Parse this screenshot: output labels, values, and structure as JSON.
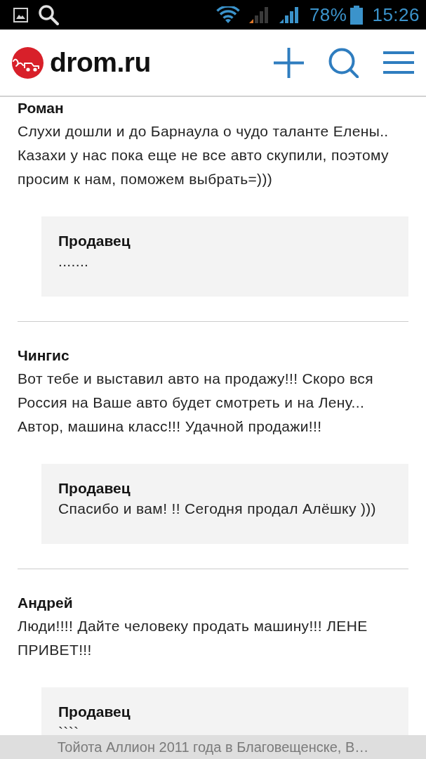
{
  "status_bar": {
    "battery": "78%",
    "time": "15:26"
  },
  "header": {
    "site_name": "drom.ru"
  },
  "comments": [
    {
      "author": "Роман",
      "text": "Слухи дошли и до Барнаула о чудо таланте Елены.. Казахи у нас пока еще не все авто скупили, поэтому просим к нам, поможем выбрать=)))",
      "reply": {
        "author": "Продавец",
        "text": "......."
      }
    },
    {
      "author": "Чингис",
      "text": "Вот тебе и выставил авто на продажу!!! Скоро вся Россия на Ваше авто будет смотреть и на Лену...\nАвтор, машина класс!!! Удачной продажи!!!",
      "reply": {
        "author": "Продавец",
        "text": "Спасибо и вам! !! Сегодня продал Алёшку )))"
      }
    },
    {
      "author": "Андрей",
      "text": "Люди!!!! Дайте человеку продать машину!!! ЛЕНЕ ПРИВЕТ!!!",
      "reply": {
        "author": "Продавец",
        "text": "````"
      }
    }
  ],
  "footer": {
    "title": "Тойота Аллион 2011 года в Благовещенске, В…"
  }
}
